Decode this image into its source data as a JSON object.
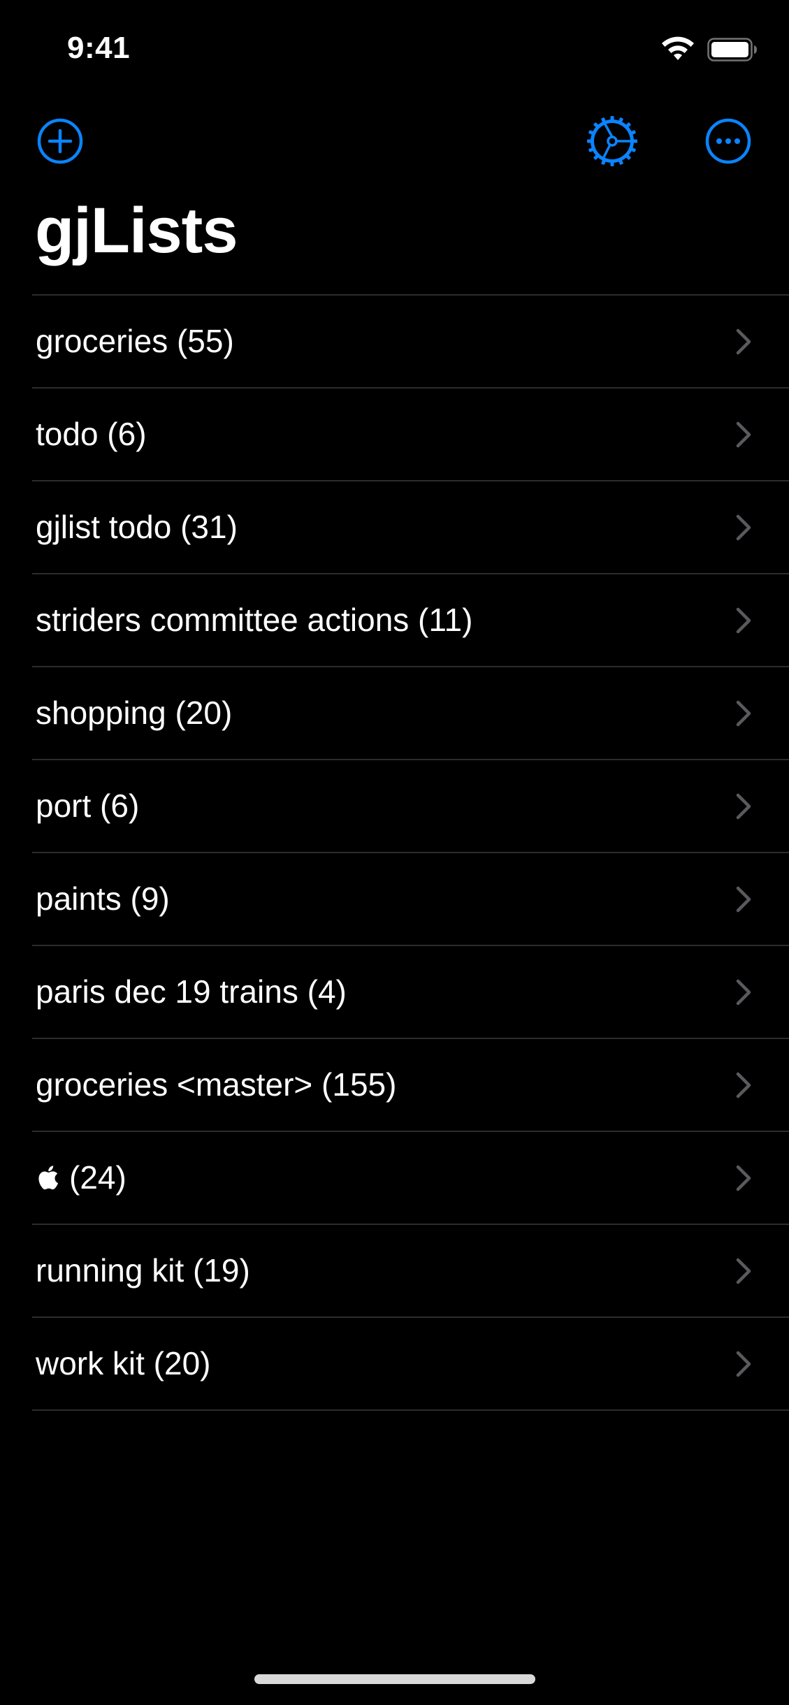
{
  "status_bar": {
    "time": "9:41"
  },
  "nav": {
    "add_icon": "plus-circle-icon",
    "settings_icon": "gear-icon",
    "more_icon": "ellipsis-circle-icon"
  },
  "page": {
    "title": "gjLists"
  },
  "lists": [
    {
      "label": "groceries (55)"
    },
    {
      "label": "todo (6)"
    },
    {
      "label": "gjlist todo (31)"
    },
    {
      "label": "striders committee actions (11)"
    },
    {
      "label": "shopping (20)"
    },
    {
      "label": "port (6)"
    },
    {
      "label": "paints (9)"
    },
    {
      "label": "paris dec 19 trains (4)"
    },
    {
      "label": "groceries <master> (155)"
    },
    {
      "label": "(24)",
      "icon": "apple-logo-icon"
    },
    {
      "label": "running kit (19)"
    },
    {
      "label": "work kit (20)"
    }
  ],
  "colors": {
    "accent": "#0a84ff",
    "background": "#000000",
    "separator": "#2c2c2e",
    "chevron": "#5a5a5e"
  }
}
